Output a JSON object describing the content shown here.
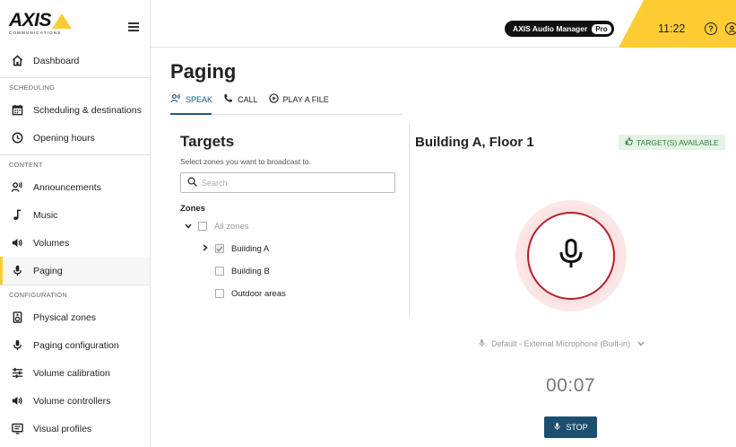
{
  "brand": {
    "logo_text": "AXIS",
    "logo_sub": "COMMUNICATIONS"
  },
  "header": {
    "product": "AXIS Audio Manager",
    "product_tier": "Pro",
    "time": "11:22",
    "accent": "#ffcc33"
  },
  "sidebar": {
    "dashboard": "Dashboard",
    "sections": {
      "scheduling": "SCHEDULING",
      "content": "CONTENT",
      "configuration": "CONFIGURATION"
    },
    "items": {
      "scheduling_destinations": "Scheduling & destinations",
      "opening_hours": "Opening hours",
      "announcements": "Announcements",
      "music": "Music",
      "volumes": "Volumes",
      "paging": "Paging",
      "physical_zones": "Physical zones",
      "paging_configuration": "Paging configuration",
      "volume_calibration": "Volume calibration",
      "volume_controllers": "Volume controllers",
      "visual_profiles": "Visual profiles"
    }
  },
  "page": {
    "title": "Paging",
    "tabs": {
      "speak": "SPEAK",
      "call": "CALL",
      "play_file": "PLAY A FILE"
    }
  },
  "targets": {
    "title": "Targets",
    "subtitle": "Select zones you want to broadcast to.",
    "search_placeholder": "Search",
    "zones_label": "Zones",
    "all_zones": "All zones",
    "zones": {
      "building_a": "Building A",
      "building_b": "Building B",
      "outdoor": "Outdoor areas"
    }
  },
  "broadcast": {
    "title": "Building A, Floor 1",
    "status": "TARGET(S) AVAILABLE",
    "microphone": "Default - External Microphone (Built-in)",
    "timer": "00:07",
    "stop_label": "STOP",
    "stop_color": "#1c4f6f",
    "record_color": "#b3202a"
  }
}
